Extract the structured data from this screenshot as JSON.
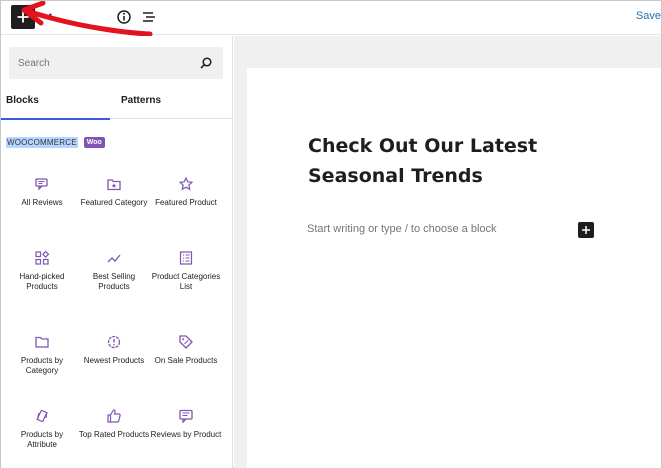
{
  "toolbar": {
    "inserter_icon": "plus-icon",
    "info_icon": "info-icon",
    "list_view_icon": "list-view-icon",
    "save_label": "Save"
  },
  "sidebar": {
    "search_placeholder": "Search",
    "tabs": [
      "Blocks",
      "Patterns"
    ],
    "category": {
      "label": "WOOCOMMERCE",
      "badge": "Woo"
    },
    "blocks": [
      {
        "label": "All Reviews",
        "icon": "reviews-icon"
      },
      {
        "label": "Featured Category",
        "icon": "featured-category-icon"
      },
      {
        "label": "Featured Product",
        "icon": "star-icon"
      },
      {
        "label": "Hand-picked Products",
        "icon": "hand-picked-icon"
      },
      {
        "label": "Best Selling Products",
        "icon": "trending-icon"
      },
      {
        "label": "Product Categories List",
        "icon": "list-icon"
      },
      {
        "label": "Products by Category",
        "icon": "folder-icon"
      },
      {
        "label": "Newest Products",
        "icon": "new-icon"
      },
      {
        "label": "On Sale Products",
        "icon": "tag-icon"
      },
      {
        "label": "Products by Attribute",
        "icon": "attribute-icon"
      },
      {
        "label": "Top Rated Products",
        "icon": "thumbs-up-icon"
      },
      {
        "label": "Reviews by Product",
        "icon": "comment-icon"
      }
    ]
  },
  "editor": {
    "title": "Check Out Our Latest Seasonal Trends",
    "placeholder": "Start writing or type / to choose a block"
  },
  "colors": {
    "accent": "#3858e9",
    "woo_purple": "#7f54b3",
    "annotation_red": "#e3121f"
  }
}
